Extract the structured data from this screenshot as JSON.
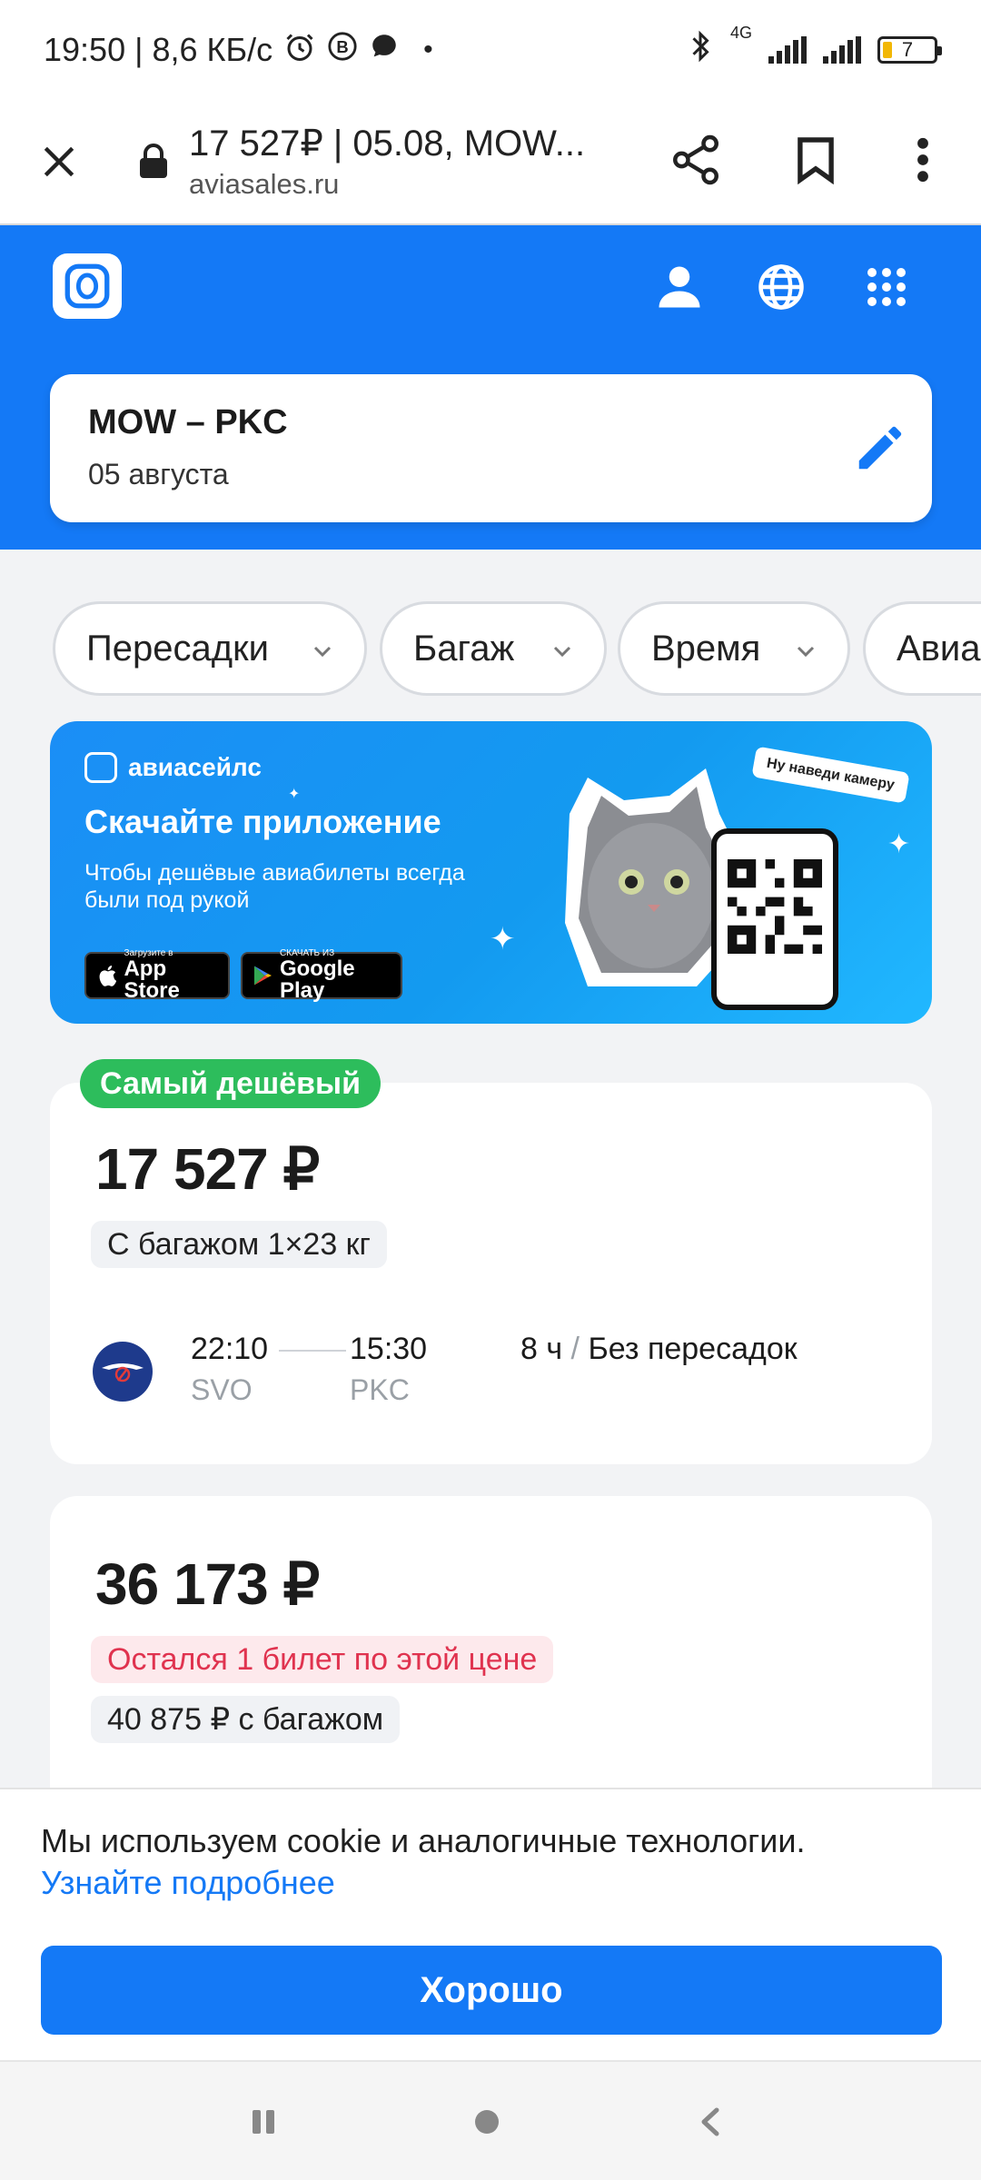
{
  "status_bar": {
    "time_speed": "19:50 | 8,6 КБ/с",
    "network": "4G",
    "battery": "7",
    "icons": [
      "alarm-icon",
      "b-circle-icon",
      "chat-bubble-icon",
      "dot-icon",
      "bluetooth-icon",
      "signal-icon",
      "battery-icon"
    ]
  },
  "browser": {
    "tab_title": "17 527₽ | 05.08, MOW...",
    "domain": "aviasales.ru",
    "icons": [
      "close-icon",
      "lock-icon",
      "share-icon",
      "bookmark-icon",
      "more-vert-icon"
    ]
  },
  "header": {
    "icons": [
      "aviasales-logo",
      "profile-icon",
      "globe-icon",
      "apps-grid-icon"
    ],
    "search": {
      "route": "MOW – PKC",
      "date": "05 августа"
    }
  },
  "filters": [
    {
      "label": "Пересадки"
    },
    {
      "label": "Багаж"
    },
    {
      "label": "Время"
    },
    {
      "label": "Авиа"
    }
  ],
  "banner": {
    "brand": "авиасейлс",
    "title": "Скачайте приложение",
    "subtitle": "Чтобы дешёвые авиабилеты всегда были под рукой",
    "app_store_small": "Загрузите в",
    "app_store": "App Store",
    "google_play_small": "СКАЧАТЬ ИЗ",
    "google_play": "Google Play",
    "sticker": "Ну наведи камеру"
  },
  "tickets": [
    {
      "badge": "Самый дешёвый",
      "price": "17 527 ₽",
      "baggage": "С багажом 1×23 кг",
      "depart_time": "22:10",
      "arrive_time": "15:30",
      "depart_airport": "SVO",
      "arrive_airport": "PKC",
      "duration": "8 ч",
      "stops": "Без пересадок"
    },
    {
      "price": "36 173 ₽",
      "warning": "Остался 1 билет по этой цене",
      "baggage_price": "40 875 ₽ с багажом"
    }
  ],
  "cookie": {
    "text": "Мы используем cookie и аналогичные технологии.",
    "link": "Узнайте подробнее",
    "button": "Хорошо"
  },
  "colors": {
    "brand_blue": "#1479f6",
    "badge_green": "#2dbd5c",
    "warning_red": "#e0334f"
  }
}
